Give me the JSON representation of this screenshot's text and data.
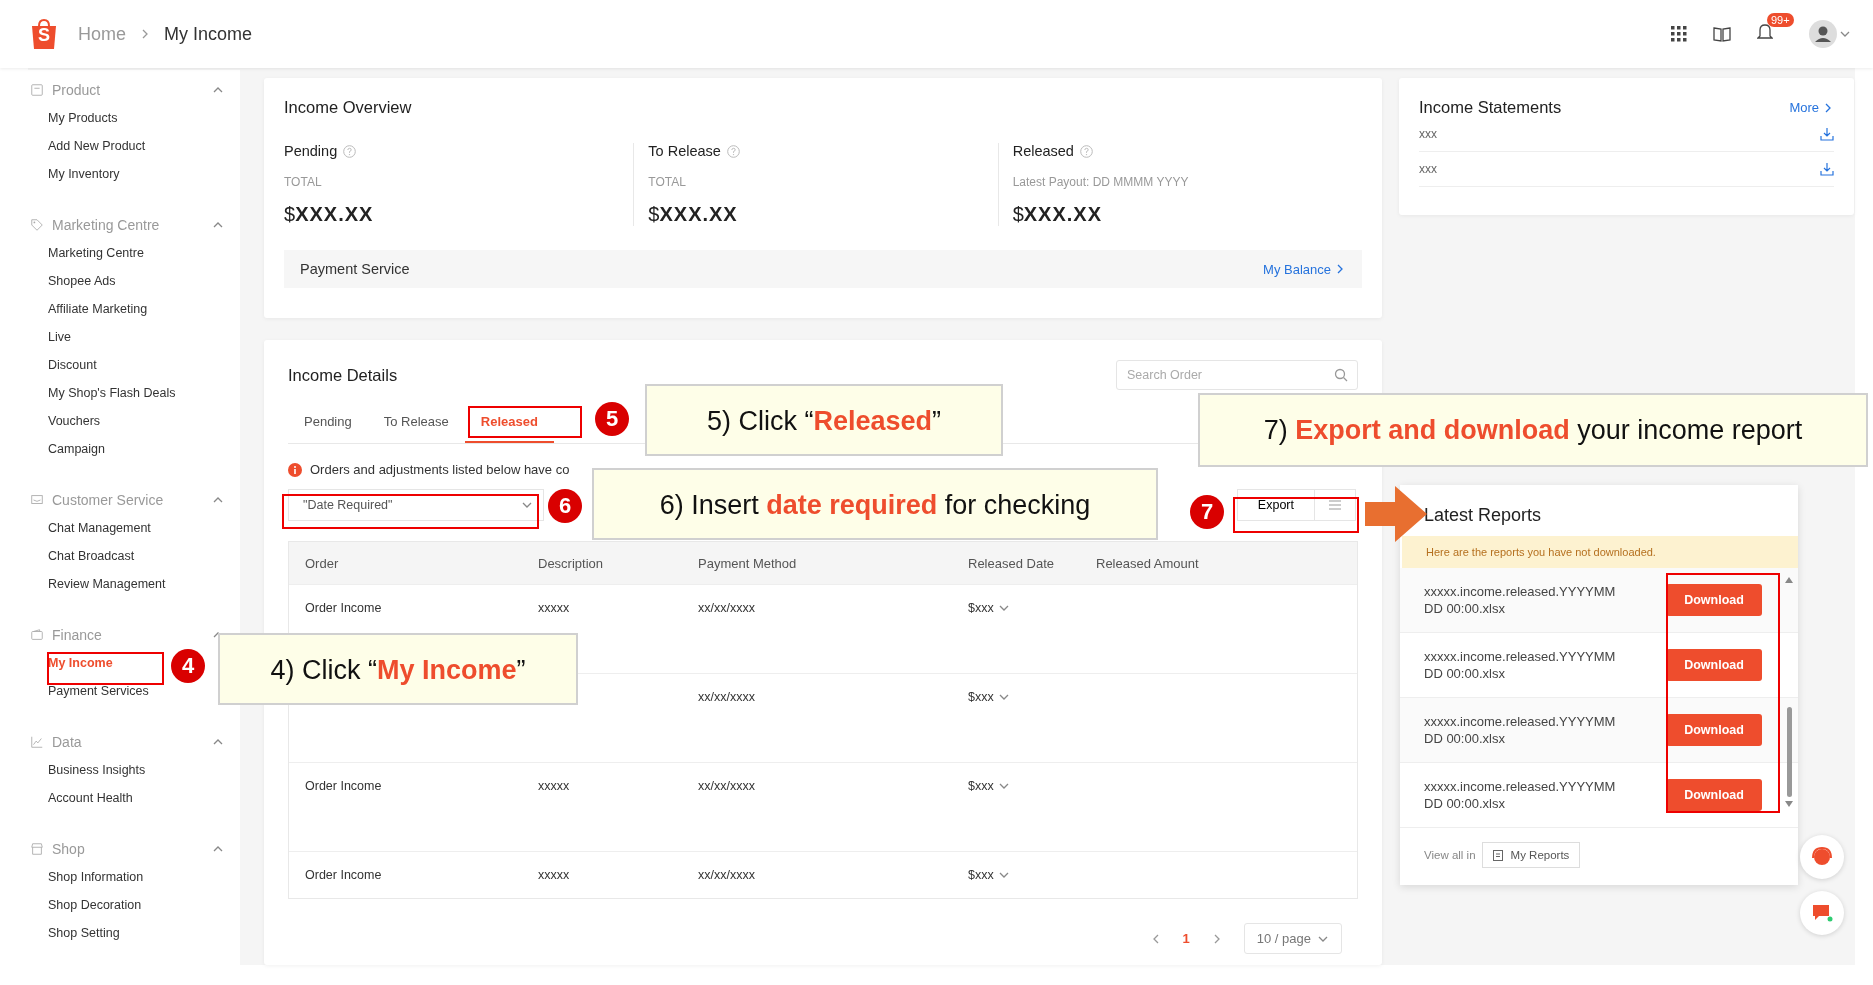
{
  "header": {
    "logo_letter": "S",
    "breadcrumb": [
      "Home",
      "My Income"
    ],
    "notification_badge": "99+"
  },
  "sidebar": [
    {
      "label": "Product",
      "expanded": true,
      "children": [
        {
          "label": "My Products",
          "selected": false
        },
        {
          "label": "Add New Product",
          "selected": false
        },
        {
          "label": "My Inventory",
          "selected": false
        }
      ]
    },
    {
      "label": "Marketing Centre",
      "expanded": true,
      "children": [
        {
          "label": "Marketing Centre",
          "selected": false
        },
        {
          "label": "Shopee Ads",
          "selected": false
        },
        {
          "label": "Affiliate Marketing",
          "selected": false
        },
        {
          "label": "Live",
          "selected": false
        },
        {
          "label": "Discount",
          "selected": false
        },
        {
          "label": "My Shop's Flash Deals",
          "selected": false
        },
        {
          "label": "Vouchers",
          "selected": false
        },
        {
          "label": "Campaign",
          "selected": false
        }
      ]
    },
    {
      "label": "Customer Service",
      "expanded": true,
      "children": [
        {
          "label": "Chat Management",
          "selected": false
        },
        {
          "label": "Chat Broadcast",
          "selected": false
        },
        {
          "label": "Review Management",
          "selected": false
        }
      ]
    },
    {
      "label": "Finance",
      "expanded": true,
      "children": [
        {
          "label": "My Income",
          "selected": true
        },
        {
          "label": "Payment Services",
          "selected": false
        }
      ]
    },
    {
      "label": "Data",
      "expanded": true,
      "children": [
        {
          "label": "Business Insights",
          "selected": false
        },
        {
          "label": "Account Health",
          "selected": false
        }
      ]
    },
    {
      "label": "Shop",
      "expanded": true,
      "children": [
        {
          "label": "Shop Information",
          "selected": false
        },
        {
          "label": "Shop Decoration",
          "selected": false
        },
        {
          "label": "Shop Setting",
          "selected": false
        }
      ]
    }
  ],
  "income_overview": {
    "title": "Income Overview",
    "columns": [
      {
        "label": "Pending",
        "sublabel": "TOTAL",
        "amount": "$**XXX.XX**"
      },
      {
        "label": "To Release",
        "sublabel": "TOTAL",
        "amount": "$**XXX.XX**"
      },
      {
        "label": "Released",
        "sublabel": "Latest Payout: DD MMMM YYYY",
        "amount": "$**XXX.XX**"
      }
    ],
    "payment_service": {
      "label": "Payment Service",
      "link": "My Balance"
    }
  },
  "income_details": {
    "title": "Income Details",
    "search_placeholder": "Search Order",
    "tabs": [
      {
        "label": "Pending",
        "selected": false
      },
      {
        "label": "To Release",
        "selected": false
      },
      {
        "label": "Released",
        "selected": true
      }
    ],
    "notice": "Orders and adjustments listed below have co",
    "date_select": "\"Date Required\"",
    "export": "Export",
    "table": {
      "columns": [
        "Order",
        "Description",
        "Payment Method",
        "Released Date",
        "Released Amount"
      ],
      "rows": [
        {
          "order": "Order Income",
          "description": "xxxxx",
          "payment_method": "xx/xx/xxxx",
          "released_date": "$xxx"
        },
        {
          "payment_method": "xx/xx/xxxx",
          "released_date": "$xxx"
        },
        {
          "order": "Order Income",
          "description": "xxxxx",
          "payment_method": "xx/xx/xxxx",
          "released_date": "$xxx"
        },
        {
          "order": "Order Income",
          "description": "xxxxx",
          "payment_method": "xx/xx/xxxx",
          "released_date": "$xxx"
        }
      ]
    },
    "pagination": {
      "page": "1",
      "page_size": "10 / page"
    }
  },
  "income_statements": {
    "title": "Income Statements",
    "more": "More",
    "items": [
      "xxx",
      "xxx"
    ]
  },
  "latest_reports": {
    "title": "Latest Reports",
    "notice": "Here are the reports you have not downloaded.",
    "reports": [
      {
        "name": "xxxxx.income.released.YYYYMM DD 00:00.xlsx",
        "button": "Download"
      },
      {
        "name": "xxxxx.income.released.YYYYMM DD 00:00.xlsx",
        "button": "Download"
      },
      {
        "name": "xxxxx.income.released.YYYYMM DD 00:00.xlsx",
        "button": "Download"
      },
      {
        "name": "xxxxx.income.released.YYYYMM DD 00:00.xlsx",
        "button": "Download"
      }
    ],
    "view_all": "View all in",
    "my_reports": "My Reports"
  },
  "annotations": [
    {
      "step": "5",
      "text": "5) Click “**Released**”"
    },
    {
      "step": "6",
      "text": "6) Insert **date required** for checking"
    },
    {
      "step": "7",
      "text": "7) **Export and download** your income report"
    },
    {
      "step": "4",
      "text": "4) Click “**My Income**”"
    }
  ]
}
